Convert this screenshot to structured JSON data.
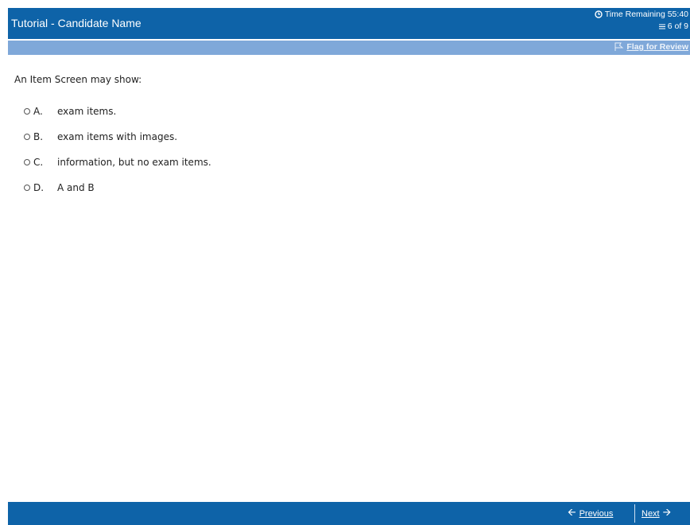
{
  "header": {
    "title": "Tutorial - Candidate Name",
    "time_remaining": "Time Remaining 55:40",
    "progress": "6 of 9"
  },
  "toolbar": {
    "flag_label": "Flag for Review"
  },
  "question": {
    "prompt": "An Item Screen may show:",
    "choices": [
      {
        "letter": "A.",
        "text": "exam items."
      },
      {
        "letter": "B.",
        "text": "exam items with images."
      },
      {
        "letter": "C.",
        "text": "information, but no exam items."
      },
      {
        "letter": "D.",
        "text": "A and B"
      }
    ]
  },
  "footer": {
    "previous_label": "Previous",
    "next_label": "Next"
  },
  "colors": {
    "header_bg": "#0e63a8",
    "subbar_bg": "#7fa8d9"
  },
  "icons": [
    "clock-icon",
    "list-icon",
    "flag-icon",
    "arrow-left-icon",
    "arrow-right-icon"
  ]
}
